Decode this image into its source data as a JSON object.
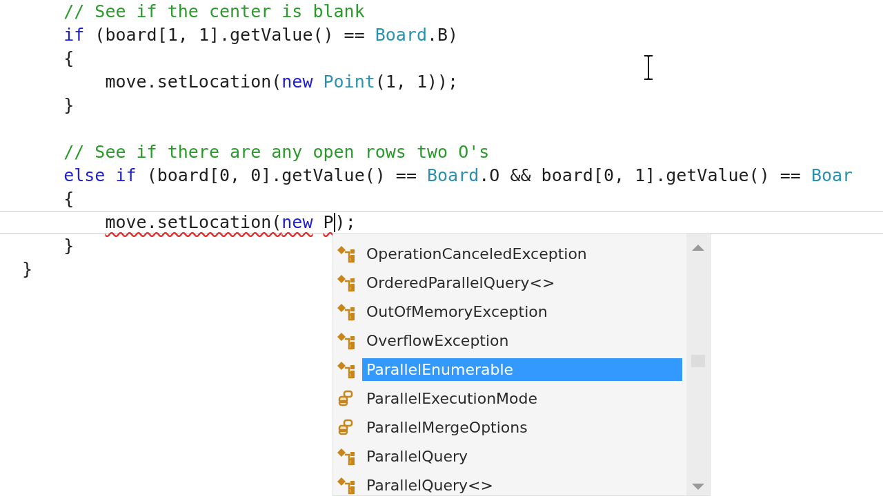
{
  "code_lines": [
    {
      "current": false,
      "tokens": [
        {
          "kind": "comment",
          "text": "    // See if the center is blank"
        }
      ]
    },
    {
      "current": false,
      "tokens": [
        {
          "kind": "keyword",
          "text": "    if"
        },
        {
          "kind": "plain",
          "text": " (board[1, 1].getValue() == "
        },
        {
          "kind": "type",
          "text": "Board"
        },
        {
          "kind": "plain",
          "text": ".B)"
        }
      ]
    },
    {
      "current": false,
      "tokens": [
        {
          "kind": "plain",
          "text": "    {"
        }
      ]
    },
    {
      "current": false,
      "tokens": [
        {
          "kind": "plain",
          "text": "        move.setLocation("
        },
        {
          "kind": "keyword",
          "text": "new"
        },
        {
          "kind": "type",
          "text": " Point"
        },
        {
          "kind": "plain",
          "text": "(1, 1));"
        }
      ]
    },
    {
      "current": false,
      "tokens": [
        {
          "kind": "plain",
          "text": "    }"
        }
      ]
    },
    {
      "current": false
    },
    {
      "current": false,
      "tokens": [
        {
          "kind": "comment",
          "text": "    // See if there are any open rows two O's"
        }
      ]
    },
    {
      "current": false,
      "tokens": [
        {
          "kind": "keyword",
          "text": "    else if"
        },
        {
          "kind": "plain",
          "text": " (board[0, 0].getValue() == "
        },
        {
          "kind": "type",
          "text": "Board"
        },
        {
          "kind": "plain",
          "text": ".O && board[0, 1].getValue() == "
        },
        {
          "kind": "type",
          "text": "Boar"
        }
      ]
    },
    {
      "current": false,
      "tokens": [
        {
          "kind": "plain",
          "text": "    {"
        }
      ]
    },
    {
      "current": true,
      "tokens": [
        {
          "kind": "plain",
          "text": "        move.setLocation(",
          "error": true
        },
        {
          "kind": "keyword",
          "text": "new",
          "error": true
        },
        {
          "kind": "plain",
          "text": " P",
          "error": true,
          "caret": true
        },
        {
          "kind": "plain",
          "text": ");"
        }
      ]
    },
    {
      "current": false,
      "tokens": [
        {
          "kind": "plain",
          "text": "    }"
        }
      ]
    },
    {
      "current": false,
      "tokens": [
        {
          "kind": "plain",
          "text": "}"
        }
      ]
    }
  ],
  "completion": {
    "items": [
      {
        "kind": "class",
        "label": "OperationCanceledException",
        "selected": false
      },
      {
        "kind": "class",
        "label": "OrderedParallelQuery<>",
        "selected": false
      },
      {
        "kind": "class",
        "label": "OutOfMemoryException",
        "selected": false
      },
      {
        "kind": "class",
        "label": "OverflowException",
        "selected": false
      },
      {
        "kind": "class",
        "label": "ParallelEnumerable",
        "selected": true
      },
      {
        "kind": "enum",
        "label": "ParallelExecutionMode",
        "selected": false
      },
      {
        "kind": "enum",
        "label": "ParallelMergeOptions",
        "selected": false
      },
      {
        "kind": "class",
        "label": "ParallelQuery",
        "selected": false
      },
      {
        "kind": "class",
        "label": "ParallelQuery<>",
        "selected": false
      }
    ]
  }
}
